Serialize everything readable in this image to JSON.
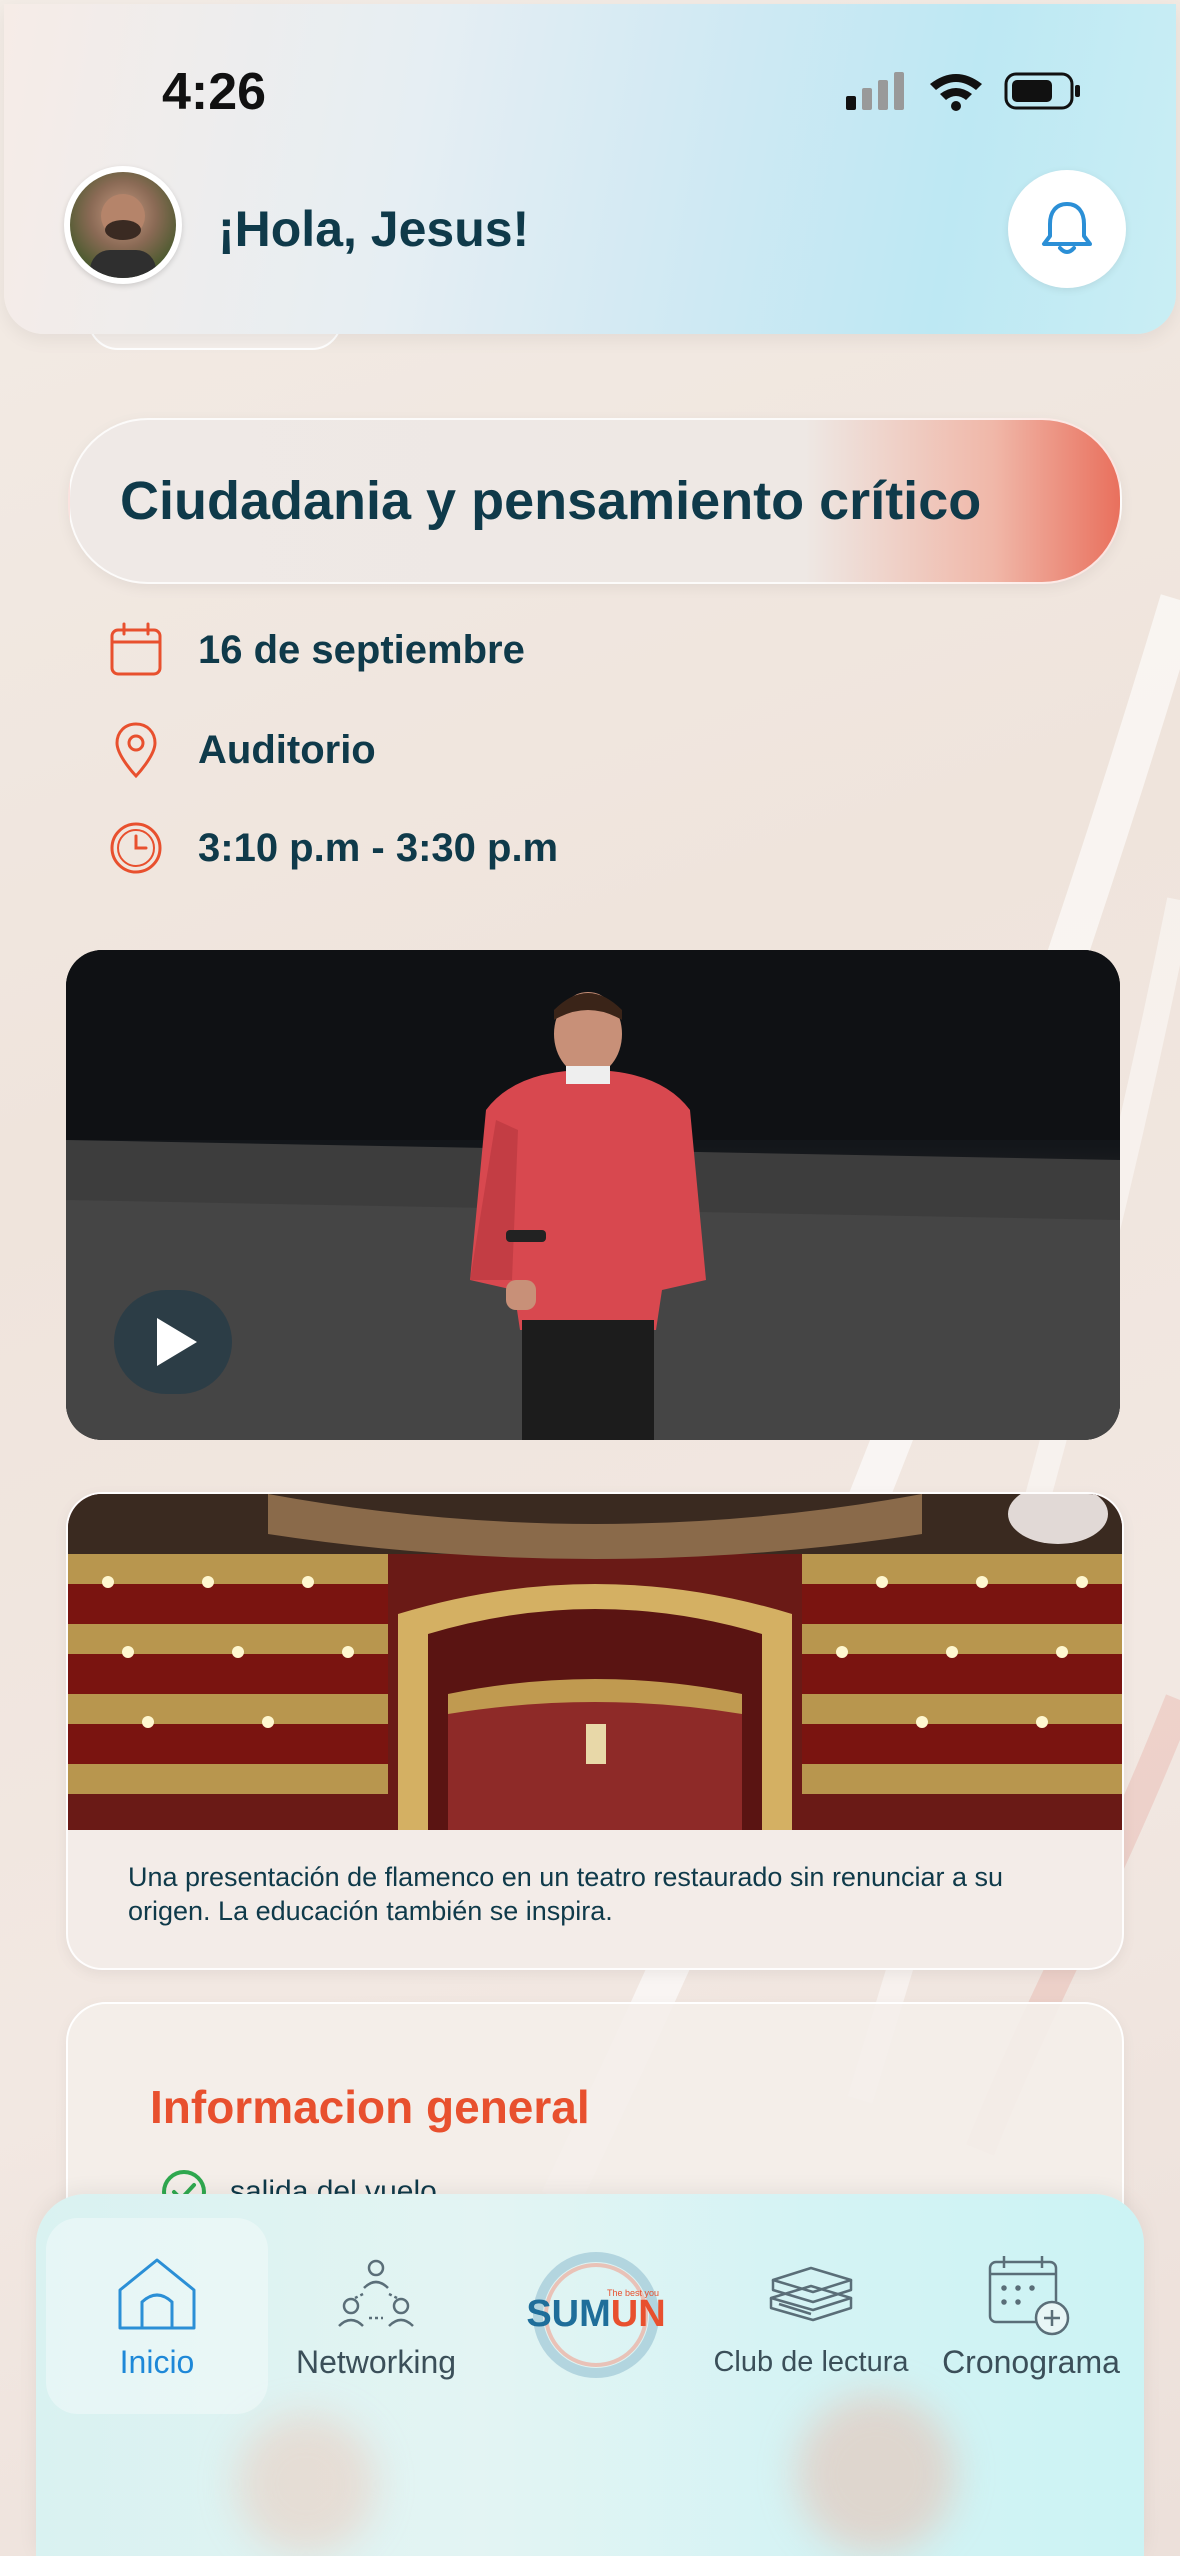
{
  "status_bar": {
    "time": "4:26"
  },
  "header": {
    "greeting": "¡Hola, Jesus!"
  },
  "event": {
    "title": "Ciudadania y pensamiento crítico",
    "date": "16 de septiembre",
    "location": "Auditorio",
    "time": "3:10 p.m - 3:30 p.m"
  },
  "theater": {
    "caption": "Una presentación de flamenco en un teatro restaurado sin renunciar a su origen. La educación también se inspira."
  },
  "info_general": {
    "title": "Informacion general",
    "items": [
      "salida del vuelo"
    ]
  },
  "nav": {
    "items": [
      {
        "label": "Inicio",
        "icon": "home-icon",
        "active": true
      },
      {
        "label": "Networking",
        "icon": "networking-icon"
      },
      {
        "label": "SUMUN",
        "icon": "sumun-logo"
      },
      {
        "label": "Club de lectura",
        "icon": "books-icon"
      },
      {
        "label": "Cronograma",
        "icon": "calendar-add-icon"
      }
    ],
    "logo_tagline": "The best you"
  },
  "colors": {
    "primary_text": "#0f3a4a",
    "accent_orange": "#e8502e",
    "active_blue": "#1e88d8"
  }
}
